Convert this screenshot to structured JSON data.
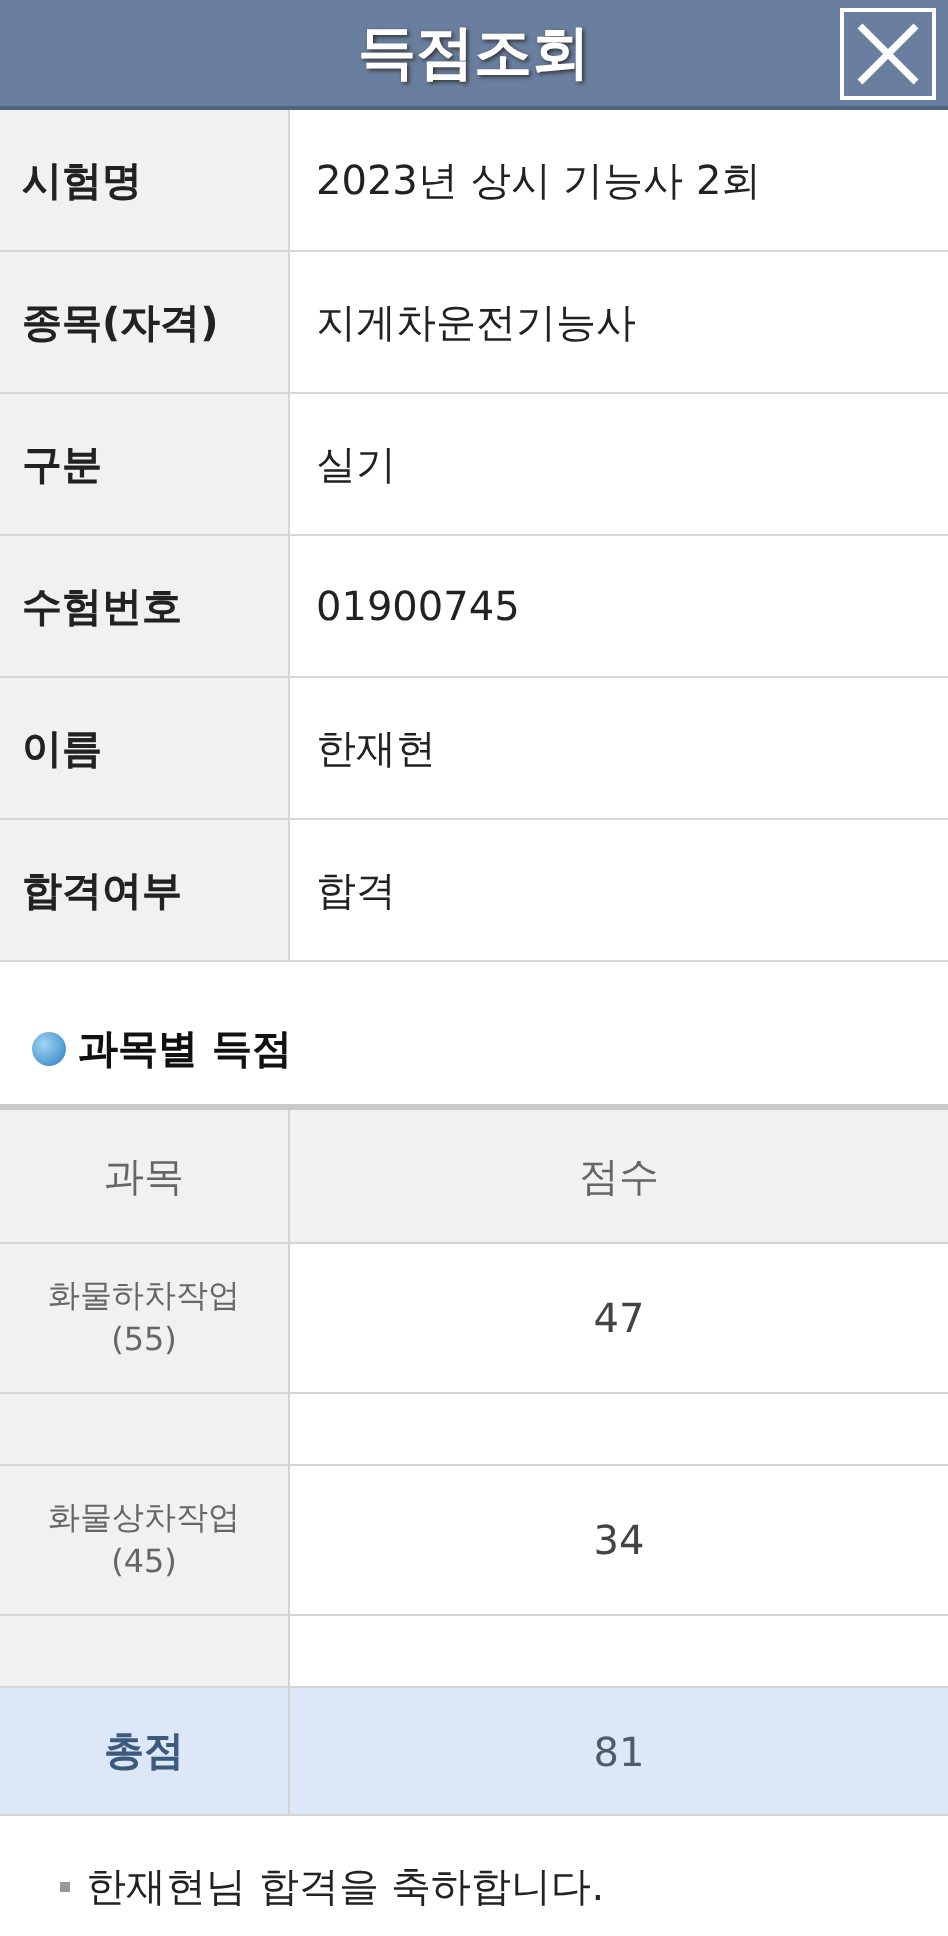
{
  "header": {
    "title": "득점조회"
  },
  "info": [
    {
      "label": "시험명",
      "value": "2023년 상시 기능사 2회"
    },
    {
      "label": "종목(자격)",
      "value": "지게차운전기능사"
    },
    {
      "label": "구분",
      "value": "실기"
    },
    {
      "label": "수험번호",
      "value": "01900745"
    },
    {
      "label": "이름",
      "value": "한재현"
    },
    {
      "label": "합격여부",
      "value": "합격"
    }
  ],
  "section_title": "과목별 득점",
  "scores": {
    "columns": [
      "과목",
      "점수"
    ],
    "rows": [
      {
        "subject": "화물하차작업",
        "max": "(55)",
        "score": "47"
      },
      {
        "subject": "화물상차작업",
        "max": "(45)",
        "score": "34"
      }
    ],
    "total": {
      "label": "총점",
      "score": "81"
    }
  },
  "message": "한재현님 합격을 축하합니다."
}
